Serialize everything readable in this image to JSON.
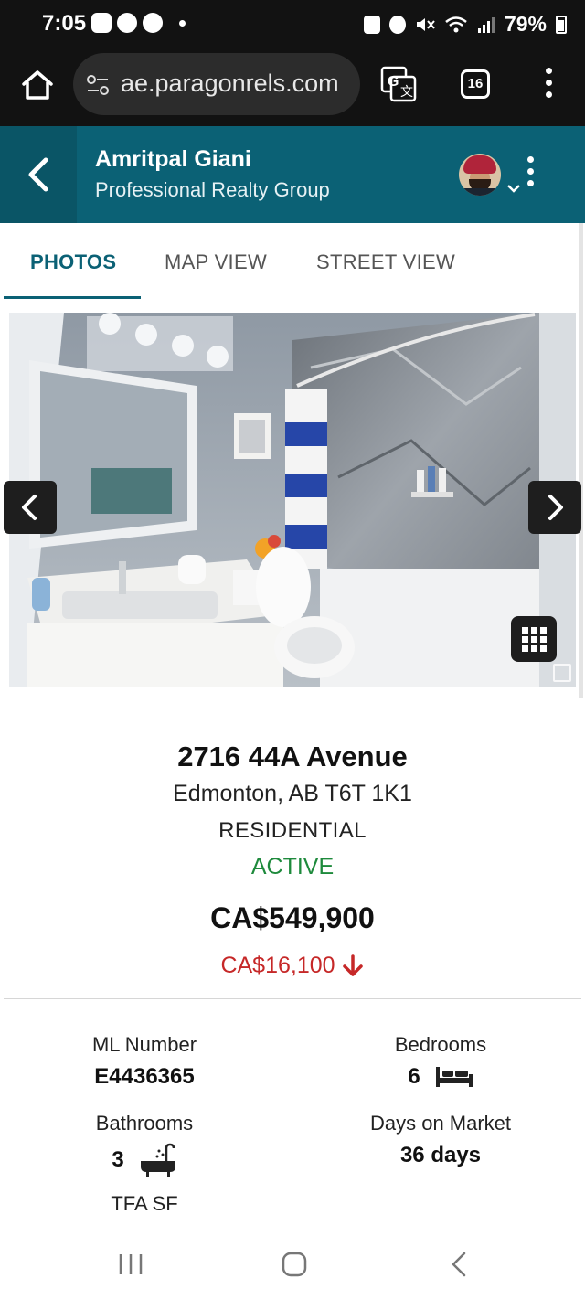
{
  "status_bar": {
    "time": "7:05",
    "battery": "79%"
  },
  "browser": {
    "url": "ae.paragonrels.com",
    "tab_count": "16"
  },
  "header": {
    "agent_name": "Amritpal Giani",
    "agent_company": "Professional Realty Group"
  },
  "tabs": [
    {
      "label": "PHOTOS",
      "active": true
    },
    {
      "label": "MAP VIEW",
      "active": false
    },
    {
      "label": "STREET VIEW",
      "active": false
    }
  ],
  "listing": {
    "address": "2716 44A Avenue",
    "city_line": "Edmonton, AB T6T 1K1",
    "property_type": "RESIDENTIAL",
    "status": "ACTIVE",
    "price": "CA$549,900",
    "price_reduction": "CA$16,100"
  },
  "stats": {
    "ml_number": {
      "label": "ML Number",
      "value": "E4436365"
    },
    "bedrooms": {
      "label": "Bedrooms",
      "value": "6"
    },
    "bathrooms": {
      "label": "Bathrooms",
      "value": "3"
    },
    "days_on_market": {
      "label": "Days on Market",
      "value": "36 days"
    },
    "tfa_sf": {
      "label": "TFA SF",
      "value": ""
    }
  },
  "colors": {
    "header_bg": "#0b6175",
    "active_status": "#1e8a3c",
    "reduction": "#c62828"
  },
  "icons": {
    "home": "home-icon",
    "translate": "translate-icon",
    "back": "chevron-left-icon",
    "bed": "bed-icon",
    "bath": "bathtub-icon",
    "grid": "grid-icon",
    "down_arrow": "arrow-down-icon"
  }
}
